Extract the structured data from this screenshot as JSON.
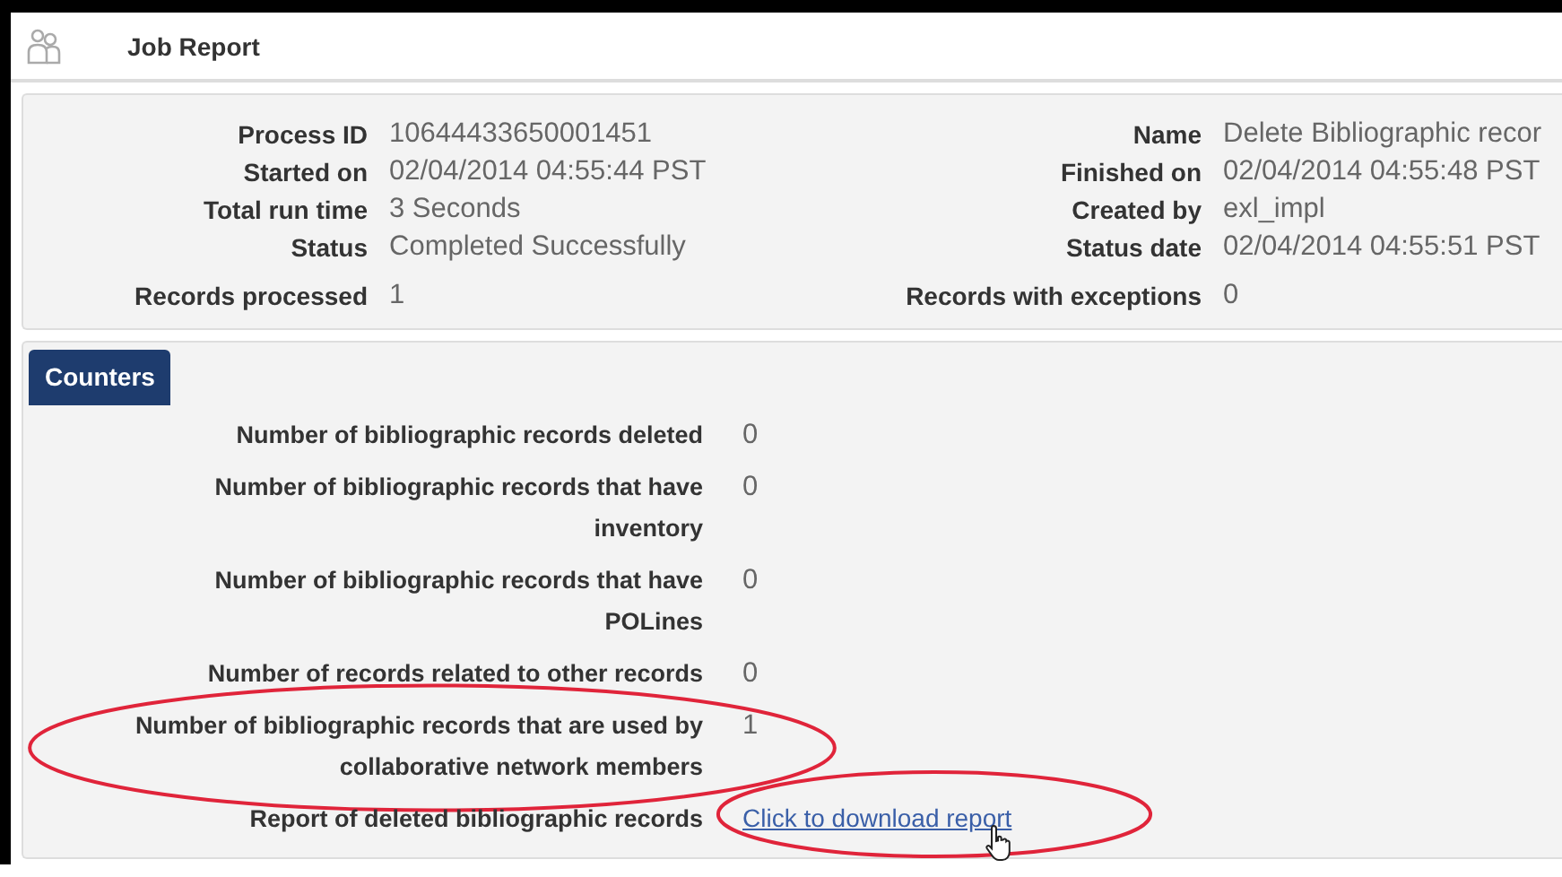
{
  "window": {
    "title": "Job Report"
  },
  "summary": {
    "left": [
      {
        "label": "Process ID",
        "value": "10644433650001451"
      },
      {
        "label": "Started on",
        "value": "02/04/2014 04:55:44 PST"
      },
      {
        "label": "Total run time",
        "value": "3 Seconds"
      },
      {
        "label": "Status",
        "value": "Completed Successfully"
      },
      {
        "label": "Records processed",
        "value": "1"
      }
    ],
    "right": [
      {
        "label": "Name",
        "value": "Delete Bibliographic recor"
      },
      {
        "label": "Finished on",
        "value": "02/04/2014 04:55:48 PST"
      },
      {
        "label": "Created by",
        "value": "exl_impl"
      },
      {
        "label": "Status date",
        "value": "02/04/2014 04:55:51 PST"
      },
      {
        "label": "Records with exceptions",
        "value": "0"
      }
    ]
  },
  "counters": {
    "tab": "Counters",
    "rows": [
      {
        "kind": "value",
        "label": "Number of bibliographic records deleted",
        "value": "0"
      },
      {
        "kind": "value",
        "label": "Number of bibliographic records that have inventory",
        "value": "0"
      },
      {
        "kind": "value",
        "label": "Number of bibliographic records that have POLines",
        "value": "0"
      },
      {
        "kind": "value",
        "label": "Number of records related to other records",
        "value": "0"
      },
      {
        "kind": "value",
        "label": "Number of bibliographic records that are used by collaborative network members",
        "value": "1",
        "highlighted": true
      },
      {
        "kind": "link",
        "label": "Report of deleted bibliographic records",
        "value": "Click to download report",
        "highlighted": true,
        "hovered": true
      }
    ]
  }
}
